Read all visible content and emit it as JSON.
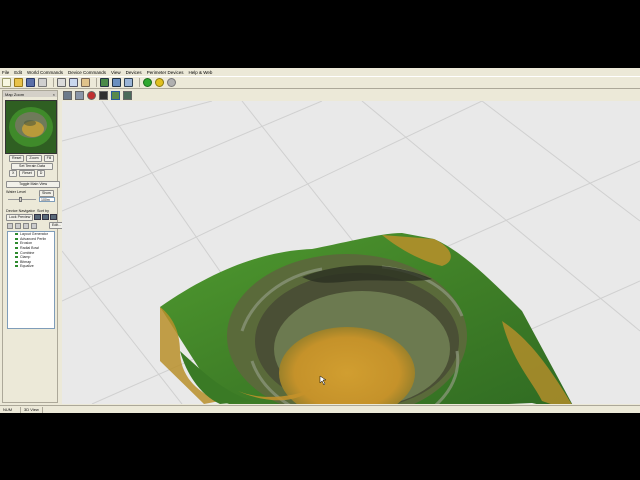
{
  "menu": [
    "File",
    "Edit",
    "World Commands",
    "Device Commands",
    "View",
    "Devices",
    "Perimeter Devices",
    "Help & Web"
  ],
  "toolbar": {
    "icons": [
      "new-icon",
      "open-icon",
      "save-icon",
      "print-icon",
      "cut-icon",
      "copy-icon",
      "paste-icon",
      "grid-icon",
      "view-icon",
      "camera-icon",
      "run-icon",
      "pause-icon",
      "stop-icon"
    ]
  },
  "view_toolbar": {
    "icons": [
      "perspective-icon",
      "top-view-icon",
      "record-icon",
      "screen-icon",
      "terrain-icon",
      "layer-icon"
    ]
  },
  "left_panel": {
    "title": "Map Zoom",
    "map_buttons": [
      "Reset",
      "Zoom",
      "Fill"
    ],
    "terrain_button": "Set Terrain Data",
    "sub_buttons": [
      "X",
      "Reset",
      "D"
    ],
    "toggle_button": "Toggle Main View",
    "water_level_label": "Water Level",
    "water_level_button": "Show",
    "water_level_value": "100m",
    "device_navigator_label": "Device Navigator",
    "sort_label": "Sort by",
    "lock_button": "Lock Preview",
    "edit_button": "Edit...",
    "devices": [
      "Layout Generator",
      "Advanced Perlin",
      "Erosion",
      "Radial Bowl",
      "Combine",
      "Clamp",
      "Bitmap",
      "Equalize"
    ]
  },
  "status": {
    "left": "NUM",
    "view": "3D View"
  },
  "colors": {
    "app_bg": "#ece9d8",
    "viewport_bg": "#e9e9e9",
    "terrain_green": "#4f9a2f",
    "terrain_sand": "#c49a2a"
  }
}
